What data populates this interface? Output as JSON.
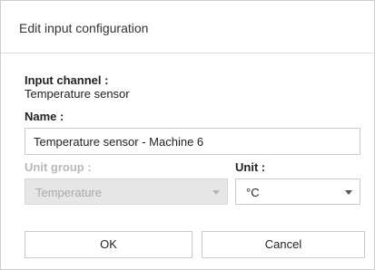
{
  "dialog": {
    "title": "Edit input configuration"
  },
  "input_channel": {
    "label": "Input channel :",
    "value": "Temperature sensor"
  },
  "name": {
    "label": "Name :",
    "value": "Temperature sensor - Machine 6"
  },
  "unit_group": {
    "label": "Unit group :",
    "selected": "Temperature",
    "disabled": true
  },
  "unit": {
    "label": "Unit :",
    "selected": "°C"
  },
  "buttons": {
    "ok_label": "OK",
    "cancel_label": "Cancel"
  }
}
